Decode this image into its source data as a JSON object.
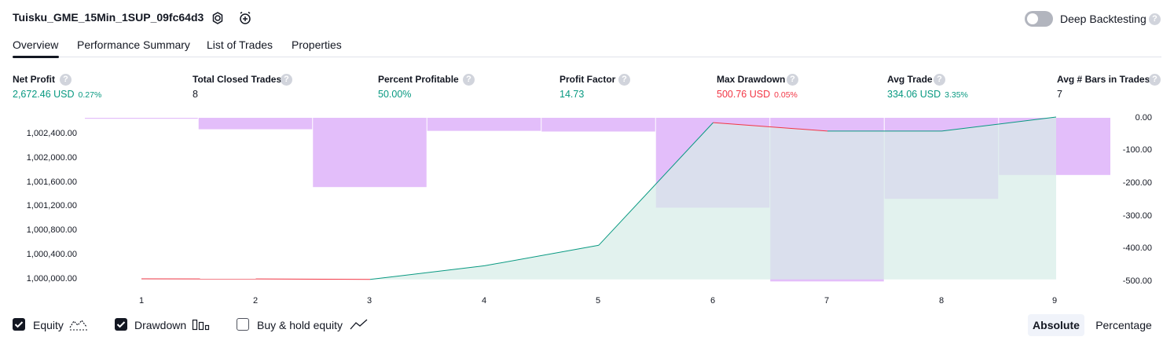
{
  "header": {
    "strategy_name": "Tuisku_GME_15Min_1SUP_09fc64d3",
    "settings_icon": "settings-gear-icon",
    "alert_icon": "add-alert-clock-icon",
    "deep_backtesting_label": "Deep Backtesting",
    "deep_backtesting_enabled": false,
    "help_glyph": "?"
  },
  "tabs": [
    {
      "label": "Overview",
      "active": true
    },
    {
      "label": "Performance Summary",
      "active": false
    },
    {
      "label": "List of Trades",
      "active": false
    },
    {
      "label": "Properties",
      "active": false
    }
  ],
  "metrics": [
    {
      "label": "Net Profit",
      "value": "2,672.46 USD",
      "pct": "0.27%",
      "color": "#089981"
    },
    {
      "label": "Total Closed Trades",
      "value": "8",
      "pct": "",
      "color": "#131722"
    },
    {
      "label": "Percent Profitable",
      "value": "50.00%",
      "pct": "",
      "color": "#089981"
    },
    {
      "label": "Profit Factor",
      "value": "14.73",
      "pct": "",
      "color": "#089981"
    },
    {
      "label": "Max Drawdown",
      "value": "500.76 USD",
      "pct": "0.05%",
      "color": "#f23645"
    },
    {
      "label": "Avg Trade",
      "value": "334.06 USD",
      "pct": "3.35%",
      "color": "#089981"
    },
    {
      "label": "Avg # Bars in Trades",
      "value": "7",
      "pct": "",
      "color": "#131722"
    }
  ],
  "legend": {
    "equity": {
      "label": "Equity",
      "checked": true,
      "icon": "equity-line-icon"
    },
    "drawdown": {
      "label": "Drawdown",
      "checked": true,
      "icon": "drawdown-bars-icon"
    },
    "buy_hold": {
      "label": "Buy & hold equity",
      "checked": false,
      "icon": "buy-hold-line-icon"
    }
  },
  "view_buttons": {
    "absolute": "Absolute",
    "percentage": "Percentage",
    "selected": "absolute"
  },
  "chart_data": {
    "type": "area",
    "x": [
      1,
      2,
      3,
      4,
      5,
      6,
      7,
      8,
      9
    ],
    "x_tick_labels": [
      "1",
      "2",
      "3",
      "4",
      "5",
      "6",
      "7",
      "8",
      "9"
    ],
    "series": [
      {
        "axis": "left",
        "kind": "line+area",
        "values": [
          1000000,
          999998,
          999990,
          1000215,
          1000555,
          1002580,
          1002440,
          1002440,
          1002672
        ],
        "color_up": "#089981",
        "color_down": "#f23645",
        "fill": "#d5ede7"
      },
      {
        "axis": "right",
        "kind": "bar",
        "values": [
          0,
          -35,
          -212,
          -40,
          -42,
          -275,
          -500.76,
          -248,
          -175
        ],
        "color": "#d9a8f8"
      }
    ],
    "left_axis": {
      "ticks": [
        1000000,
        1000400,
        1000800,
        1001200,
        1001600,
        1002000,
        1002400
      ],
      "tick_labels": [
        "1,000,000.00",
        "1,000,400.00",
        "1,000,800.00",
        "1,001,200.00",
        "1,001,600.00",
        "1,002,000.00",
        "1,002,400.00"
      ],
      "range": [
        999990,
        1002672
      ]
    },
    "right_axis": {
      "ticks": [
        0,
        -100,
        -200,
        -300,
        -400,
        -500
      ],
      "tick_labels": [
        "0.00",
        "-100.00",
        "-200.00",
        "-300.00",
        "-400.00",
        "-500.00"
      ],
      "range": [
        -500.76,
        0
      ]
    },
    "grid": false
  }
}
